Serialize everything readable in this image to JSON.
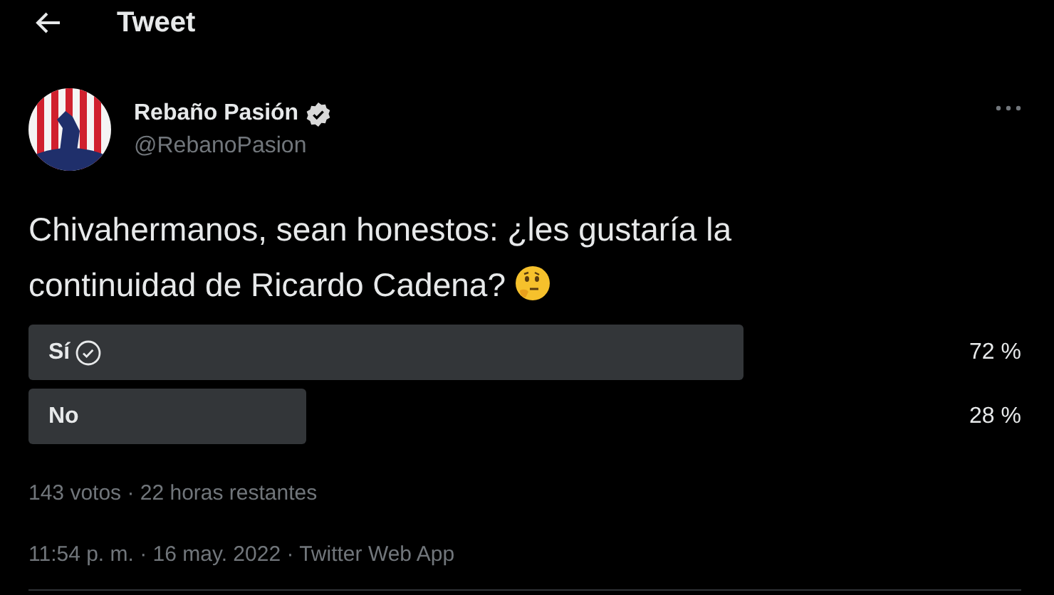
{
  "header": {
    "title": "Tweet"
  },
  "author": {
    "name": "Rebaño Pasión",
    "verified": true,
    "handle": "@RebanoPasion"
  },
  "tweet": {
    "text": "Chivahermanos, sean honestos: ¿les gustaría la continuidad de Ricardo Cadena?"
  },
  "poll": {
    "options": [
      {
        "label": "Sí",
        "level": 0.72,
        "percent": "72 %",
        "winner": true
      },
      {
        "label": "No",
        "level": 0.28,
        "percent": "28 %",
        "winner": false
      }
    ],
    "summary": "143 votos · 22 horas restantes"
  },
  "timestamp": "11:54 p. m. · 16 may. 2022 · Twitter Web App"
}
